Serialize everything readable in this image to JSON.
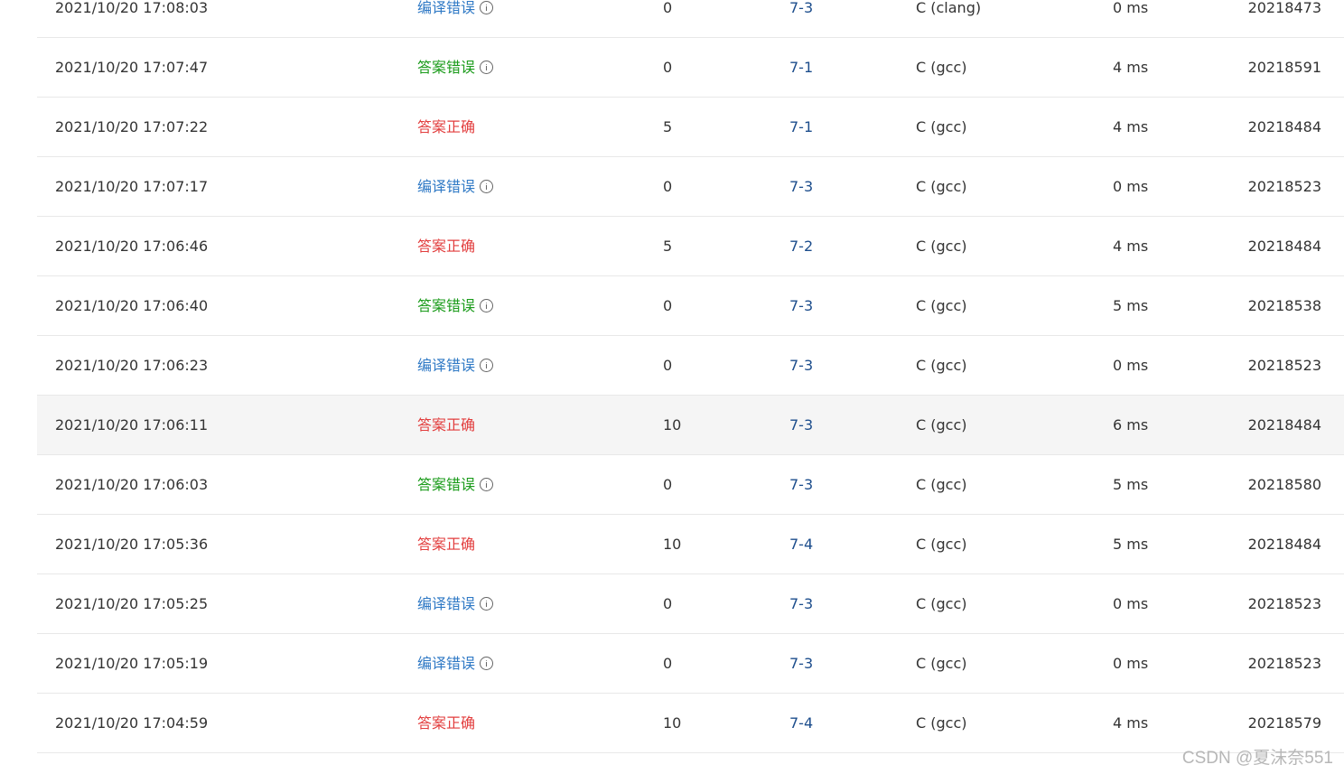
{
  "colors": {
    "compile_error": "#2f79c5",
    "wrong_answer": "#1a9b1a",
    "accepted": "#e23d3d",
    "problem_link": "#1c4d8c",
    "row_highlight": "#f5f5f5"
  },
  "rows": [
    {
      "time": "2021/10/20 17:08:03",
      "status": "编译错误",
      "status_type": "compile_error",
      "has_info": true,
      "score": "0",
      "problem": "7-3",
      "compiler": "C (clang)",
      "run_time": "0 ms",
      "user": "20218473"
    },
    {
      "time": "2021/10/20 17:07:47",
      "status": "答案错误",
      "status_type": "wrong_answer",
      "has_info": true,
      "score": "0",
      "problem": "7-1",
      "compiler": "C (gcc)",
      "run_time": "4 ms",
      "user": "20218591"
    },
    {
      "time": "2021/10/20 17:07:22",
      "status": "答案正确",
      "status_type": "accepted",
      "has_info": false,
      "score": "5",
      "problem": "7-1",
      "compiler": "C (gcc)",
      "run_time": "4 ms",
      "user": "20218484"
    },
    {
      "time": "2021/10/20 17:07:17",
      "status": "编译错误",
      "status_type": "compile_error",
      "has_info": true,
      "score": "0",
      "problem": "7-3",
      "compiler": "C (gcc)",
      "run_time": "0 ms",
      "user": "20218523"
    },
    {
      "time": "2021/10/20 17:06:46",
      "status": "答案正确",
      "status_type": "accepted",
      "has_info": false,
      "score": "5",
      "problem": "7-2",
      "compiler": "C (gcc)",
      "run_time": "4 ms",
      "user": "20218484"
    },
    {
      "time": "2021/10/20 17:06:40",
      "status": "答案错误",
      "status_type": "wrong_answer",
      "has_info": true,
      "score": "0",
      "problem": "7-3",
      "compiler": "C (gcc)",
      "run_time": "5 ms",
      "user": "20218538"
    },
    {
      "time": "2021/10/20 17:06:23",
      "status": "编译错误",
      "status_type": "compile_error",
      "has_info": true,
      "score": "0",
      "problem": "7-3",
      "compiler": "C (gcc)",
      "run_time": "0 ms",
      "user": "20218523"
    },
    {
      "time": "2021/10/20 17:06:11",
      "status": "答案正确",
      "status_type": "accepted",
      "has_info": false,
      "score": "10",
      "problem": "7-3",
      "compiler": "C (gcc)",
      "run_time": "6 ms",
      "user": "20218484",
      "highlight": true
    },
    {
      "time": "2021/10/20 17:06:03",
      "status": "答案错误",
      "status_type": "wrong_answer",
      "has_info": true,
      "score": "0",
      "problem": "7-3",
      "compiler": "C (gcc)",
      "run_time": "5 ms",
      "user": "20218580"
    },
    {
      "time": "2021/10/20 17:05:36",
      "status": "答案正确",
      "status_type": "accepted",
      "has_info": false,
      "score": "10",
      "problem": "7-4",
      "compiler": "C (gcc)",
      "run_time": "5 ms",
      "user": "20218484"
    },
    {
      "time": "2021/10/20 17:05:25",
      "status": "编译错误",
      "status_type": "compile_error",
      "has_info": true,
      "score": "0",
      "problem": "7-3",
      "compiler": "C (gcc)",
      "run_time": "0 ms",
      "user": "20218523"
    },
    {
      "time": "2021/10/20 17:05:19",
      "status": "编译错误",
      "status_type": "compile_error",
      "has_info": true,
      "score": "0",
      "problem": "7-3",
      "compiler": "C (gcc)",
      "run_time": "0 ms",
      "user": "20218523"
    },
    {
      "time": "2021/10/20 17:04:59",
      "status": "答案正确",
      "status_type": "accepted",
      "has_info": false,
      "score": "10",
      "problem": "7-4",
      "compiler": "C (gcc)",
      "run_time": "4 ms",
      "user": "20218579"
    }
  ],
  "watermark": "CSDN @夏沫奈551"
}
